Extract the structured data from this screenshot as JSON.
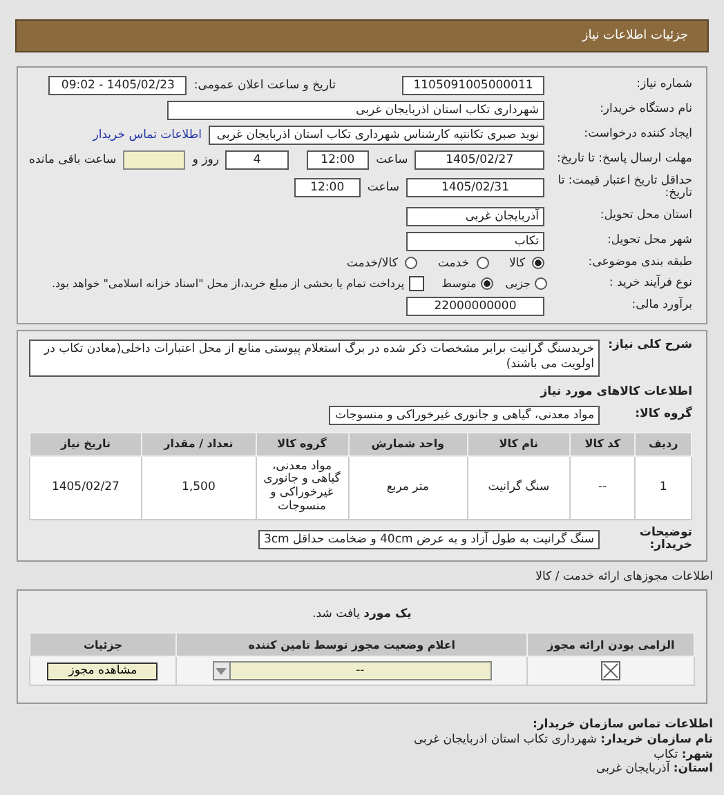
{
  "header": {
    "title": "جزئیات اطلاعات نیاز"
  },
  "need_number": {
    "label": "شماره نیاز:",
    "value": "1105091005000011"
  },
  "announce": {
    "label": "تاریخ و ساعت اعلان عمومی:",
    "value": "1405/02/23 - 09:02"
  },
  "buyer": {
    "label": "نام دستگاه خریدار:",
    "value": "شهرداری تکاب استان اذربایجان غربی"
  },
  "requester": {
    "label": "ایجاد کننده درخواست:",
    "value": "نوید صبری تکانتپه کارشناس شهرداری تکاب استان اذربایجان غربی",
    "link": "اطلاعات تماس خریدار"
  },
  "deadline": {
    "label": "مهلت ارسال پاسخ: تا تاریخ:",
    "date": "1405/02/27",
    "time_label": "ساعت",
    "time": "12:00",
    "days": "4",
    "days_label": "روز و",
    "remaining_label": "ساعت باقی مانده"
  },
  "validity": {
    "label": "حداقل تاریخ اعتبار قیمت: تا تاریخ:",
    "date": "1405/02/31",
    "time_label": "ساعت",
    "time": "12:00"
  },
  "province": {
    "label": "استان محل تحویل:",
    "value": "آذربایجان غربی"
  },
  "city": {
    "label": "شهر محل تحویل:",
    "value": "تکاب"
  },
  "category": {
    "label": "طبقه بندی موضوعی:",
    "options": [
      {
        "label": "کالا",
        "selected": true
      },
      {
        "label": "خدمت",
        "selected": false
      },
      {
        "label": "کالا/خدمت",
        "selected": false
      }
    ]
  },
  "process": {
    "label": "نوع فرآیند خرید :",
    "options": [
      {
        "label": "جزیی",
        "selected": false
      },
      {
        "label": "متوسط",
        "selected": true
      }
    ],
    "treasury": {
      "checked": false,
      "text": "پرداخت تمام یا بخشی از مبلغ خرید،از محل \"اسناد خزانه اسلامی\" خواهد بود."
    }
  },
  "budget": {
    "label": "برآورد مالی:",
    "value": "22000000000"
  },
  "summary": {
    "label": "شرح کلی نیاز:",
    "text": "خریدسنگ گرانیت برابر مشخصات ذکر شده در برگ استعلام پیوستی منابع از محل اعتبارات داخلی(معادن تکاب در اولویت می باشند)"
  },
  "goods": {
    "title": "اطلاعات کالاهای مورد نیاز",
    "group_label": "گروه کالا:",
    "group": "مواد معدنی، گیاهی و جانوری غیرخوراکی و منسوجات",
    "table": {
      "columns": [
        "ردیف",
        "کد کالا",
        "نام کالا",
        "واحد شمارش",
        "گروه کالا",
        "تعداد / مقدار",
        "تاریخ نیاز"
      ],
      "rows": [
        [
          "1",
          "--",
          "سنگ گرانیت",
          "متر مربع",
          "مواد معدنی، گیاهی و جانوری غیرخوراکی و منسوجات",
          "1,500",
          "1405/02/27"
        ]
      ]
    },
    "notes_label": "توضیحات خریدار:",
    "notes": "سنگ گرانیت به طول آزاد و به عرض 40cm و ضخامت حداقل 3cm"
  },
  "permits": {
    "title": "اطلاعات مجوزهای ارائه خدمت / کالا",
    "found": "**یک مورد** یافت شد.",
    "columns": [
      "الزامی بودن ارائه مجوز",
      "اعلام وضعیت مجوز توسط تامین کننده",
      "جزئیات"
    ],
    "rows": [
      {
        "required": true,
        "status": "--",
        "button": "مشاهده مجوز"
      }
    ]
  },
  "contact": {
    "title": "اطلاعات تماس سازمان خریدار:",
    "items": [
      {
        "label": "نام سازمان خریدار:",
        "value": "شهرداری تکاب استان اذربایجان غربی"
      },
      {
        "label": "شهر:",
        "value": "تکاب"
      },
      {
        "label": "استان:",
        "value": "آذربایجان غربی"
      }
    ]
  }
}
